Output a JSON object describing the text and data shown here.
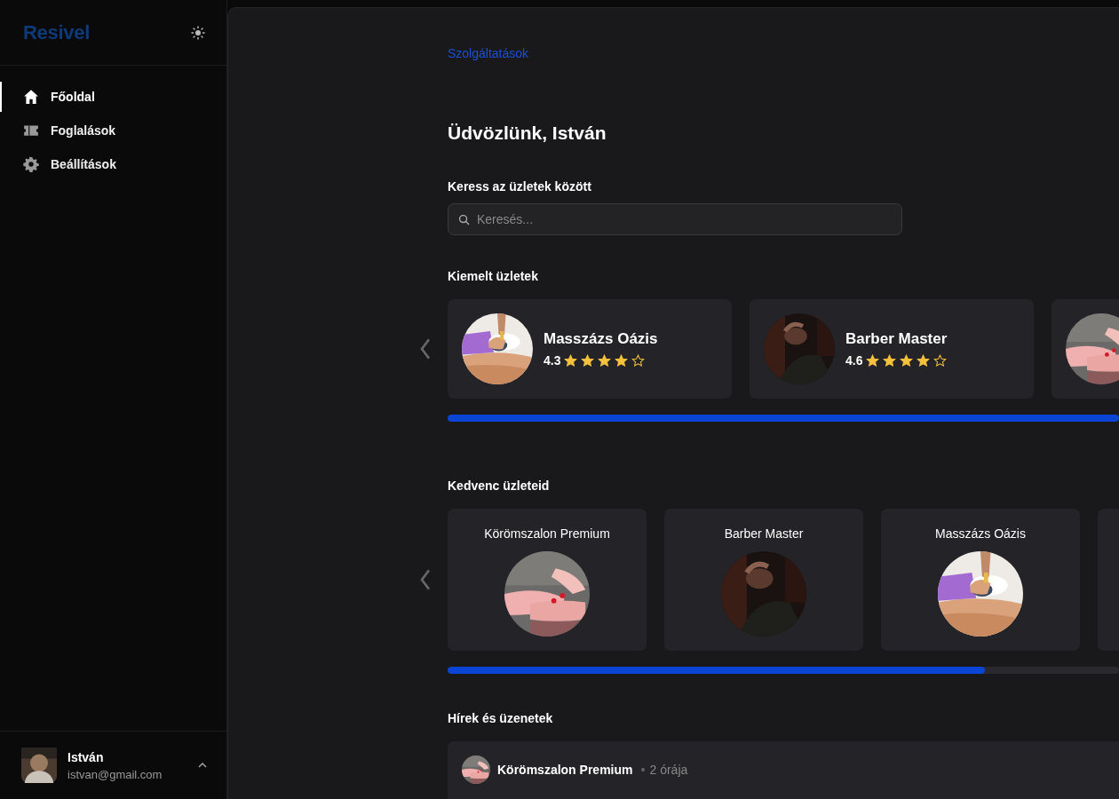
{
  "sidebar": {
    "logo": "Resivel",
    "items": [
      {
        "label": "Főoldal",
        "selected": true
      },
      {
        "label": "Foglalások",
        "selected": false
      },
      {
        "label": "Beállítások",
        "selected": false
      }
    ],
    "user": {
      "name": "István",
      "email": "istvan@gmail.com"
    }
  },
  "breadcrumb": "Szolgáltatások",
  "greeting": "Üdvözlünk, István",
  "search": {
    "label": "Keress az üzletek között",
    "placeholder": "Keresés..."
  },
  "featured": {
    "title": "Kiemelt üzletek",
    "level": 1,
    "shops": [
      {
        "name": "Masszázs Oázis",
        "rating": "4.3",
        "stars": 4
      },
      {
        "name": "Barber Master",
        "rating": "4.6",
        "stars": 4
      },
      {
        "kind": "picture"
      }
    ]
  },
  "favorites": {
    "title": "Kedvenc üzleteid",
    "level": 0.8,
    "shops": [
      {
        "name": "Körömszalon Premium"
      },
      {
        "name": "Barber Master"
      },
      {
        "name": "Masszázs Oázis"
      }
    ]
  },
  "news": {
    "title": "Hírek és üzenetek",
    "items": [
      {
        "shop": "Körömszalon Premium",
        "time": "2 órája"
      }
    ]
  }
}
